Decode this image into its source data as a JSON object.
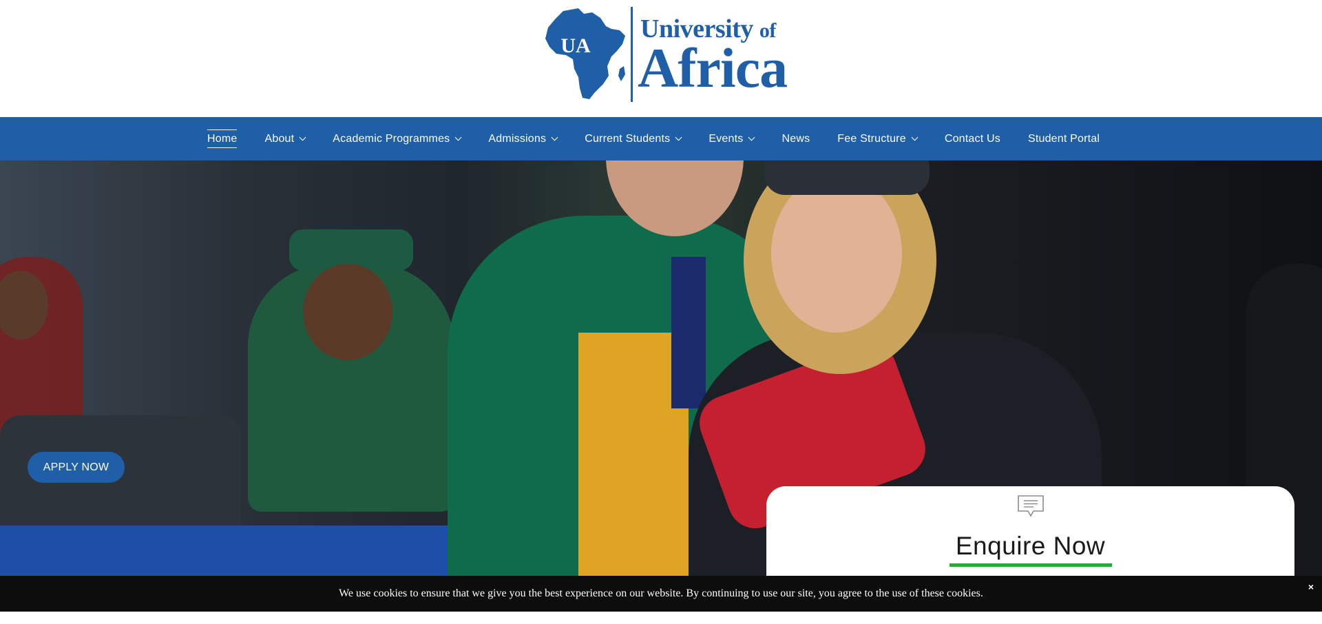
{
  "brand": {
    "monogram": "UA",
    "name_line1": "University",
    "name_line1_suffix": "of",
    "name_line2": "Africa",
    "color": "#1f5fa8"
  },
  "nav": {
    "items": [
      {
        "label": "Home",
        "active": true,
        "dropdown": false
      },
      {
        "label": "About",
        "dropdown": true
      },
      {
        "label": "Academic Programmes",
        "dropdown": true
      },
      {
        "label": "Admissions",
        "dropdown": true
      },
      {
        "label": "Current Students",
        "dropdown": true
      },
      {
        "label": "Events",
        "dropdown": true
      },
      {
        "label": "News",
        "dropdown": false
      },
      {
        "label": "Fee Structure",
        "dropdown": true
      },
      {
        "label": "Contact Us",
        "dropdown": false
      },
      {
        "label": "Student Portal",
        "dropdown": false
      }
    ]
  },
  "hero": {
    "apply_label": "APPLY NOW"
  },
  "enquire": {
    "icon": "chat-bubble-icon",
    "title": "Enquire Now",
    "accent": "#2ea836"
  },
  "cookie": {
    "message": "We use cookies to ensure that we give you the best experience on our website. By continuing to use our site, you agree to the use of these cookies.",
    "close_label": "×"
  }
}
